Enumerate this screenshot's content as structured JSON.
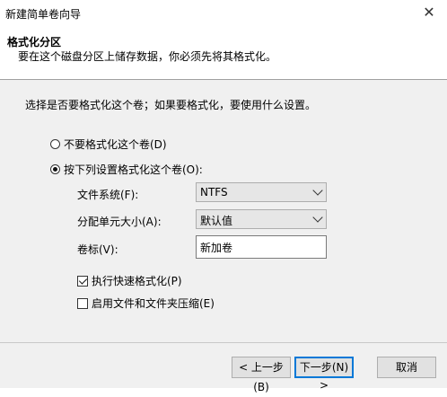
{
  "window": {
    "title": "新建简单卷向导"
  },
  "header": {
    "title": "格式化分区",
    "subtitle": "要在这个磁盘分区上储存数据，你必须先将其格式化。"
  },
  "body": {
    "intro": "选择是否要格式化这个卷；如果要格式化，要使用什么设置。",
    "radio_no_format": "不要格式化这个卷(D)",
    "radio_format": "按下列设置格式化这个卷(O):",
    "fs_label": "文件系统(F):",
    "fs_value": "NTFS",
    "alloc_label": "分配单元大小(A):",
    "alloc_value": "默认值",
    "volume_label": "卷标(V):",
    "volume_value": "新加卷",
    "quick_format": "执行快速格式化(P)",
    "compression": "启用文件和文件夹压缩(E)"
  },
  "footer": {
    "back": "< 上一步(B)",
    "next": "下一步(N) >",
    "cancel": "取消"
  }
}
